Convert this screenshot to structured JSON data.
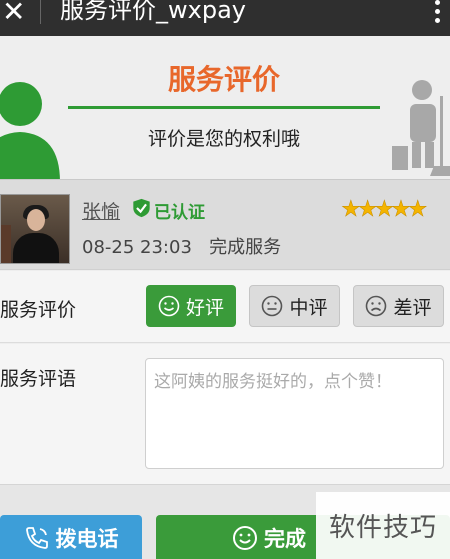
{
  "window": {
    "title": "服务评价_wxpay"
  },
  "header": {
    "title": "服务评价",
    "subtitle": "评价是您的权利哦"
  },
  "worker": {
    "name": "张愉",
    "verified_label": "已认证",
    "rating_stars": 5,
    "stars_text": "★★★★★",
    "time": "08-25 23:03",
    "status": "完成服务"
  },
  "rating": {
    "label": "服务评价",
    "options": [
      "好评",
      "中评",
      "差评"
    ],
    "selected": "好评"
  },
  "comment": {
    "label": "服务评语",
    "placeholder": "这阿姨的服务挺好的，点个赞！"
  },
  "actions": {
    "call_label": "拨电话",
    "done_label": "完成"
  },
  "watermark": "软件技巧",
  "colors": {
    "accent_green": "#3a9b3a",
    "title_orange": "#e8672b",
    "call_blue": "#3d9ed8",
    "star_gold": "#f4b400"
  }
}
